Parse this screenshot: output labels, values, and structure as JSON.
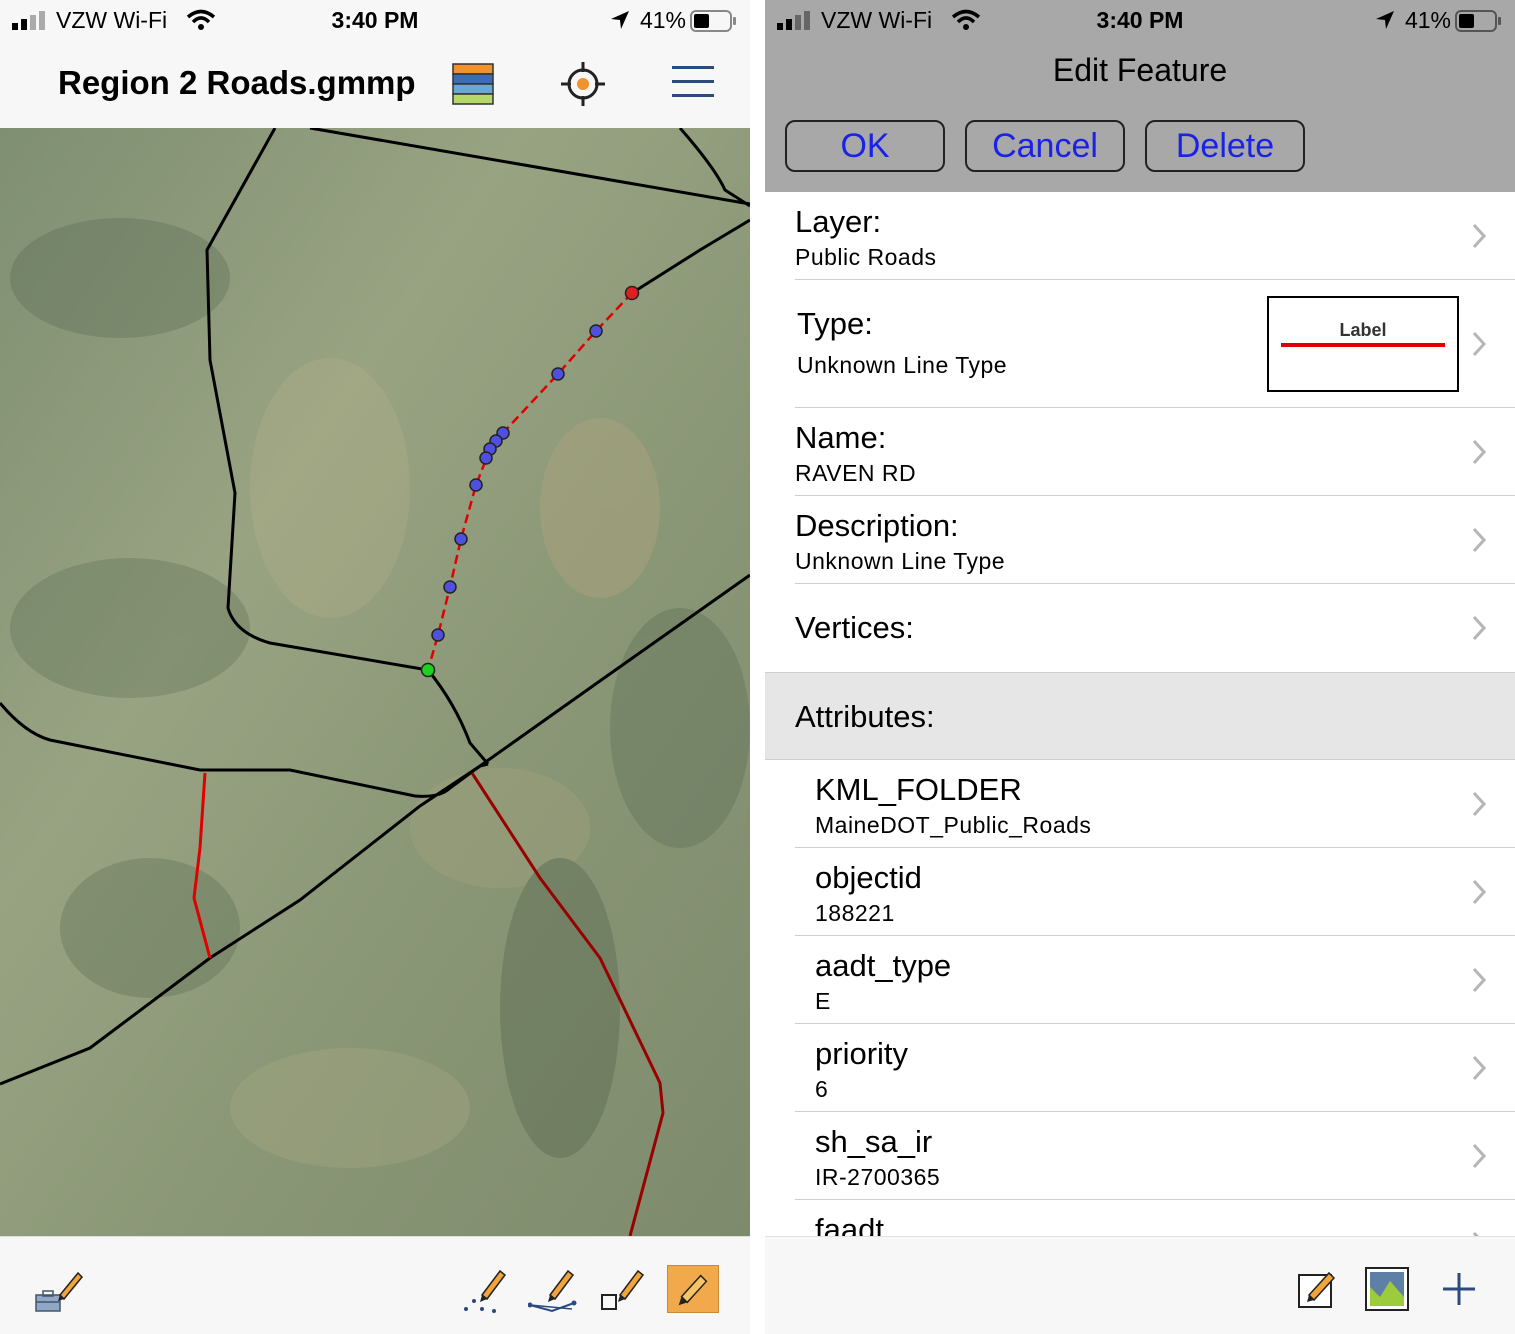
{
  "left_status": {
    "carrier": "VZW Wi-Fi",
    "time": "3:40 PM",
    "battery": "41%"
  },
  "right_status": {
    "carrier": "VZW Wi-Fi",
    "time": "3:40 PM",
    "battery": "41%"
  },
  "map_view": {
    "title": "Region 2 Roads.gmmp",
    "header_icons": [
      "layers-icon",
      "locate-icon",
      "menu-icon"
    ],
    "toolbar_icons": [
      "toolbox-pencil-icon",
      "draw-points-icon",
      "draw-line-icon",
      "draw-area-icon",
      "edit-pencil-icon"
    ],
    "colors": {
      "road": "#000000",
      "selected_line": "#e00000",
      "vertex": "#5050e0",
      "start_vertex": "#20d020",
      "end_vertex": "#e02020",
      "other_road": "#990000"
    }
  },
  "edit_feature": {
    "title": "Edit Feature",
    "buttons": {
      "ok": "OK",
      "cancel": "Cancel",
      "delete": "Delete"
    },
    "layer": {
      "label": "Layer:",
      "value": "Public Roads"
    },
    "type": {
      "label": "Type:",
      "value": "Unknown Line Type",
      "preview_label": "Label"
    },
    "name": {
      "label": "Name:",
      "value": "RAVEN RD"
    },
    "description": {
      "label": "Description:",
      "value": "Unknown Line Type"
    },
    "vertices": {
      "label": "Vertices:"
    },
    "attributes_header": "Attributes:",
    "attributes": [
      {
        "label": "KML_FOLDER",
        "value": "MaineDOT_Public_Roads"
      },
      {
        "label": "objectid",
        "value": "188221"
      },
      {
        "label": "aadt_type",
        "value": "E"
      },
      {
        "label": "priority",
        "value": "6"
      },
      {
        "label": "sh_sa_ir",
        "value": "IR-2700365"
      },
      {
        "label": "faadt",
        "value": ""
      }
    ],
    "toolbar_icons": [
      "edit-note-icon",
      "photo-icon",
      "add-icon"
    ],
    "accent": "#1a22e8"
  }
}
